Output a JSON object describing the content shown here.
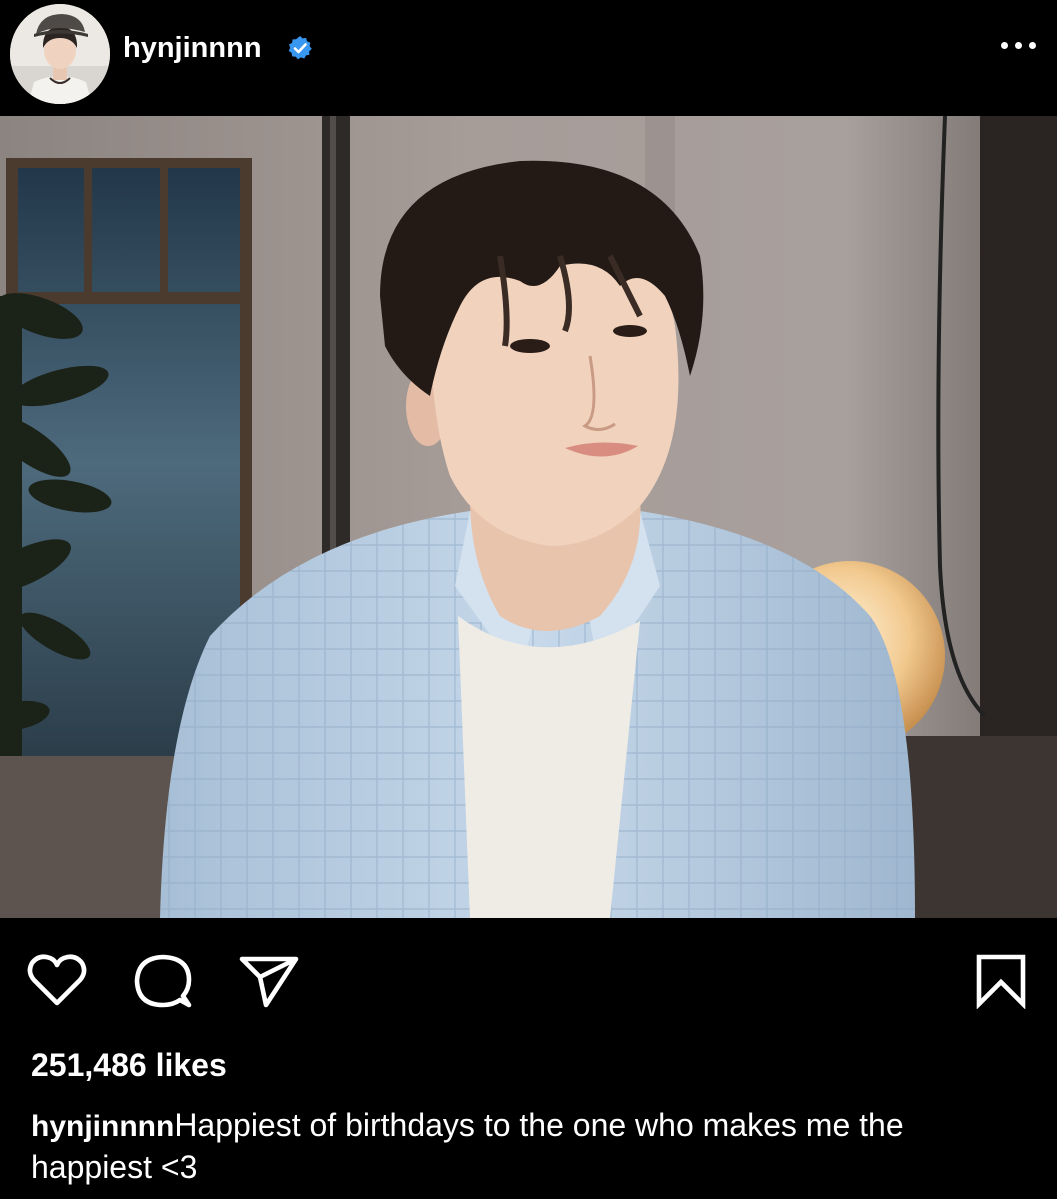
{
  "post": {
    "username": "hynjinnnn",
    "verified": true,
    "avatar_icon": "profile-avatar",
    "more_icon": "more-options-icon",
    "likes_text": "251,486 likes",
    "caption_user": "hynjinnnn",
    "caption_text": "Happiest of birthdays to the one who makes me the happiest <3"
  },
  "actions": {
    "like_icon": "heart-icon",
    "comment_icon": "comment-icon",
    "share_icon": "send-icon",
    "save_icon": "bookmark-icon"
  },
  "colors": {
    "background": "#000000",
    "text": "#ffffff",
    "verified_badge": "#3897f0",
    "shirt": "#b9cfe4"
  }
}
